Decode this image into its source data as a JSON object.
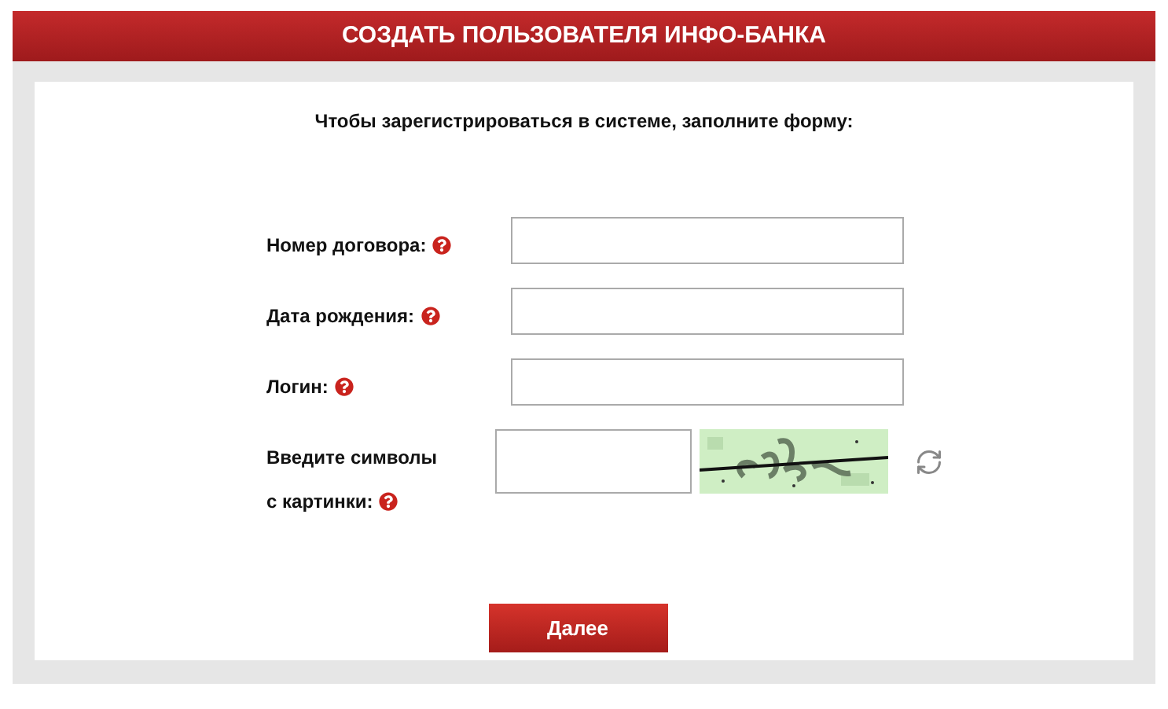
{
  "header": {
    "title": "СОЗДАТЬ ПОЛЬЗОВАТЕЛЯ ИНФО-БАНКА"
  },
  "intro": "Чтобы зарегистрироваться в системе, заполните форму:",
  "fields": [
    {
      "kind": "text",
      "label_lines": [
        "Номер договора:"
      ]
    },
    {
      "kind": "text",
      "label_lines": [
        "Дата рождения:"
      ]
    },
    {
      "kind": "text",
      "label_lines": [
        "Логин:"
      ]
    },
    {
      "kind": "captcha",
      "label_lines": [
        "Введите символы",
        "с картинки:"
      ]
    }
  ],
  "submit": "Далее"
}
